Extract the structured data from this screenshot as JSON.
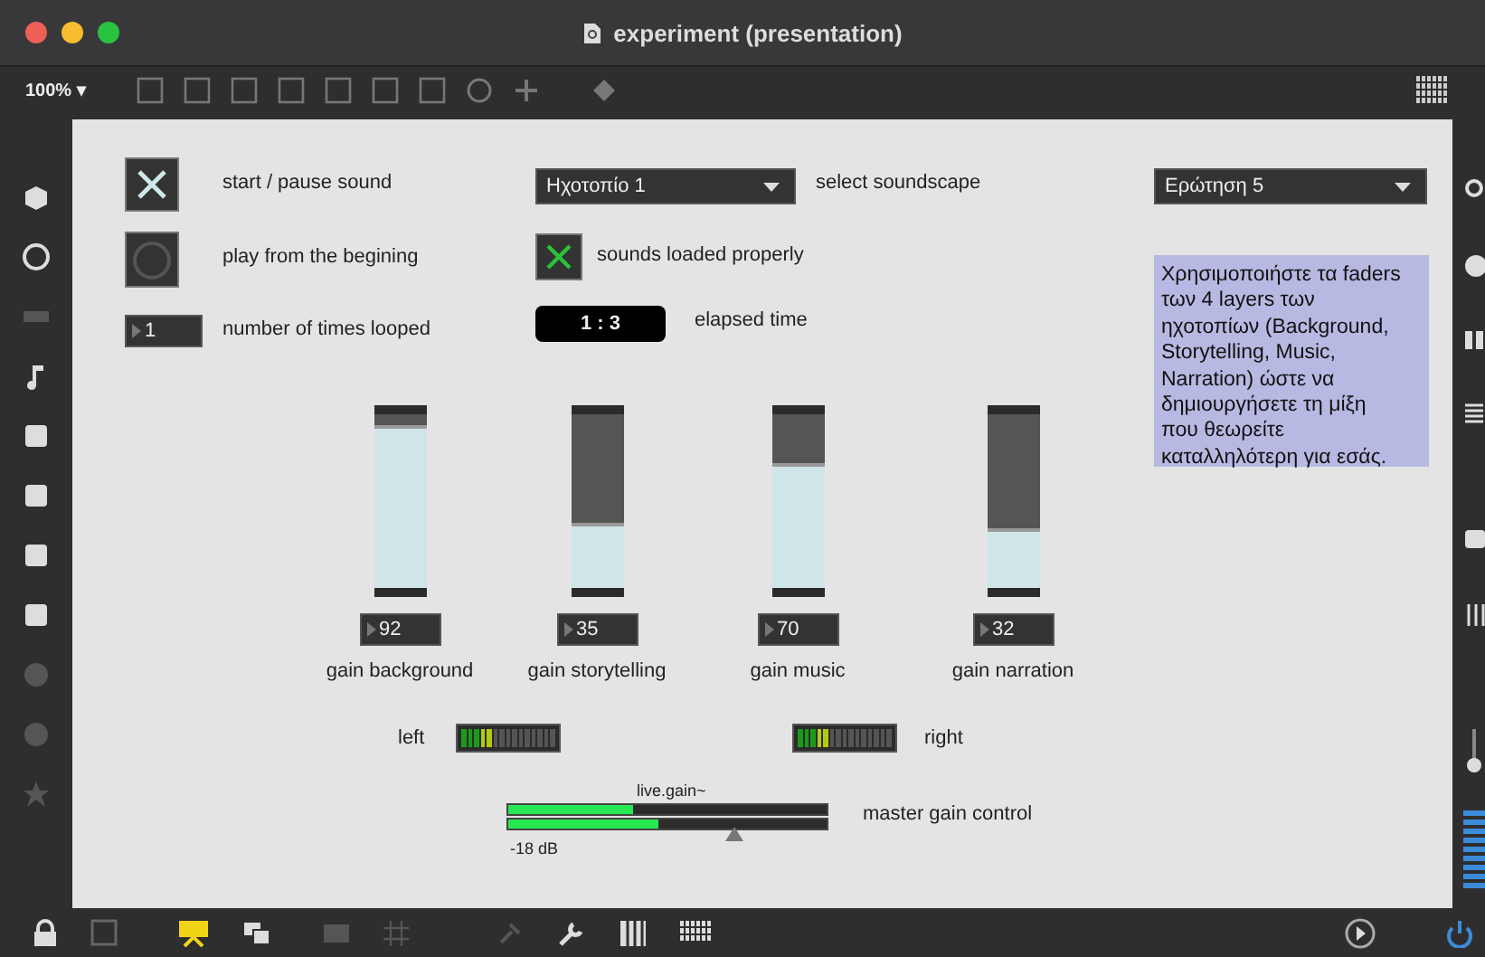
{
  "window": {
    "title": "experiment (presentation)"
  },
  "toolbar": {
    "zoom": "100%",
    "zoom_caret": "▾"
  },
  "controls": {
    "start_toggle": {
      "checked": true
    },
    "start_label": "start / pause sound",
    "play_label": "play from the begining",
    "loop_count": "1",
    "loop_label": "number of times looped",
    "soundscape_menu": "Ηχοτοπίο 1",
    "soundscape_label": "select soundscape",
    "loaded_toggle": {
      "checked": true
    },
    "loaded_label": "sounds loaded properly",
    "elapsed": "1 : 3",
    "elapsed_label": "elapsed time",
    "question_menu": "Ερώτηση 5",
    "comment": "Χρησιμοποιήστε τα faders των 4 layers των ηχοτοπίων (Background, Storytelling, Music, Narration) ώστε να δημιουργήσετε τη μίξη που θεωρείτε καταλληλότερη για εσάς."
  },
  "faders": [
    {
      "value": "92",
      "label": "gain background",
      "level": 0.92
    },
    {
      "value": "35",
      "label": "gain storytelling",
      "level": 0.35
    },
    {
      "value": "70",
      "label": "gain music",
      "level": 0.7
    },
    {
      "value": "32",
      "label": "gain narration",
      "level": 0.32
    }
  ],
  "meters": [
    {
      "label": "left",
      "level": 0.33
    },
    {
      "label": "right",
      "level": 0.33
    }
  ],
  "master": {
    "title": "live.gain~",
    "reading": "-18 dB",
    "label": "master gain control",
    "level": 0.71,
    "signal": [
      {
        "level": 0.39
      },
      {
        "level": 0.47
      }
    ]
  }
}
